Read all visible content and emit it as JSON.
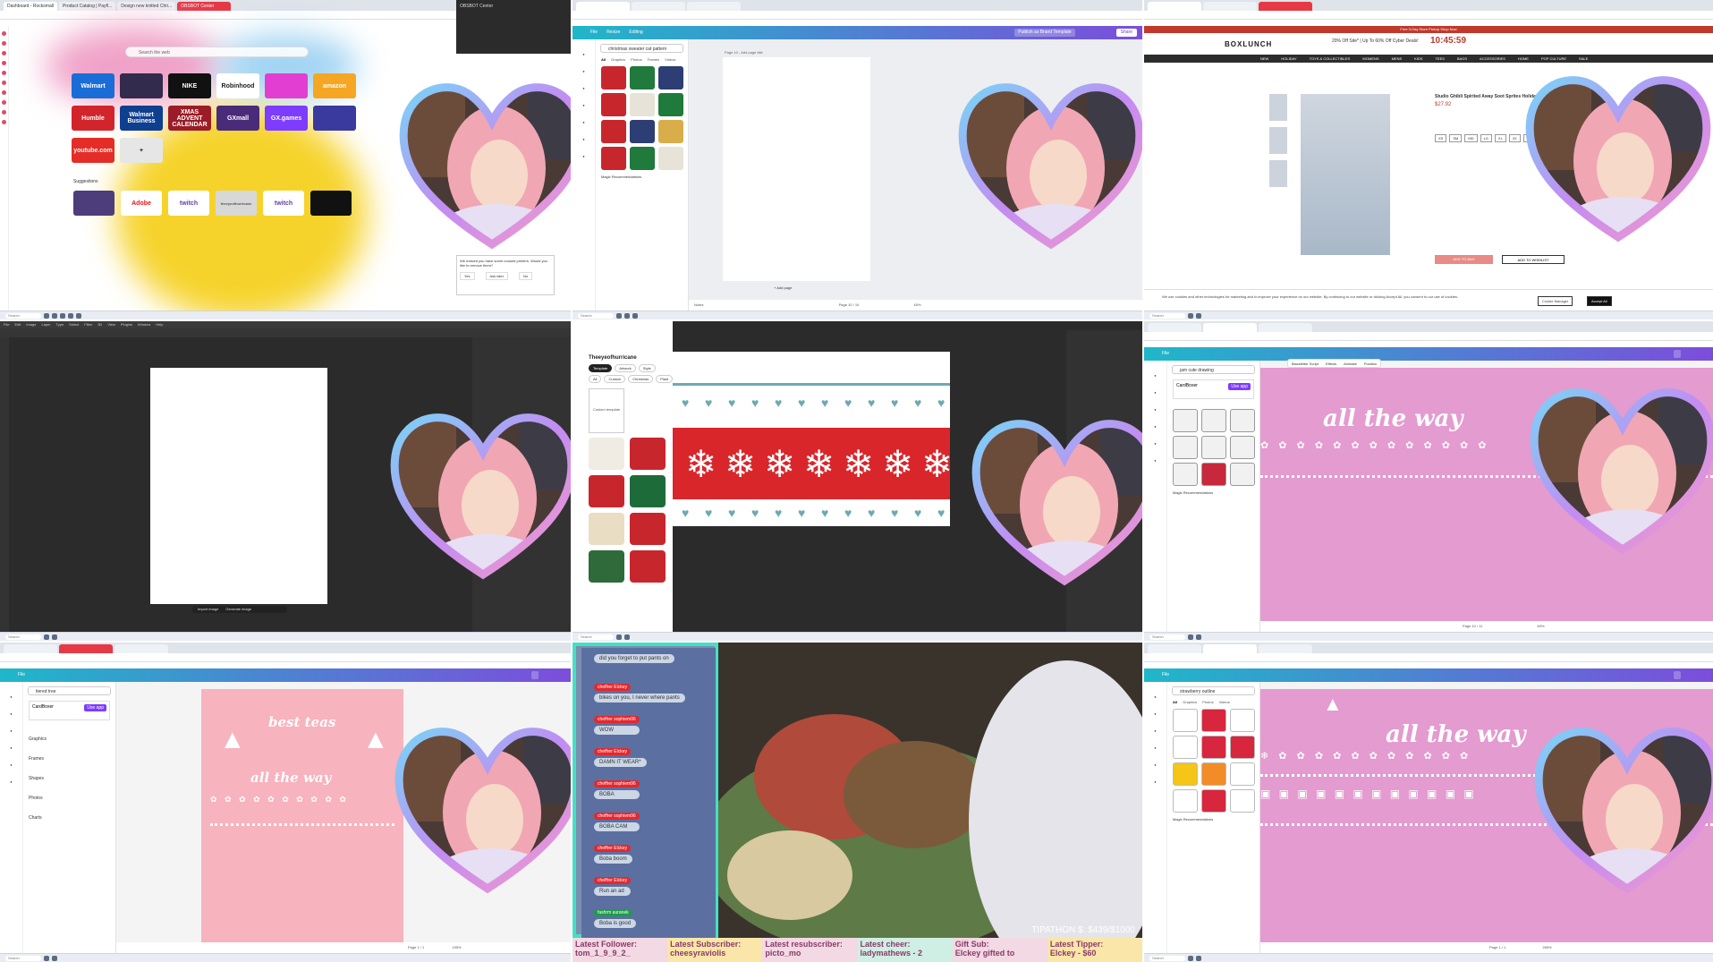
{
  "taskbar": {
    "search": "Search"
  },
  "cell1": {
    "tabs": [
      "Dashboard - Rocksmall",
      "Product Catalog | Payfl...",
      "Design new knitted Chri...",
      "OBSBOT Center"
    ],
    "search_placeholder": "Search the web",
    "speed_dial": [
      {
        "label": "Walmart",
        "color": "#1a6dd6"
      },
      {
        "label": "",
        "color": "#332b4d"
      },
      {
        "label": "NIKE",
        "color": "#111111"
      },
      {
        "label": "Robinhood",
        "color": "#ffffff"
      },
      {
        "label": "",
        "color": "#e23fd2"
      },
      {
        "label": "amazon",
        "color": "#f5a623"
      },
      {
        "label": "Humble",
        "color": "#d2252b"
      },
      {
        "label": "Walmart Business",
        "color": "#0f3f8f"
      },
      {
        "label": "XMAS ADVENT CALENDAR",
        "color": "#9b1c26"
      },
      {
        "label": "GXmall",
        "color": "#4a2b7a"
      },
      {
        "label": "GX.games",
        "color": "#7d3cff"
      },
      {
        "label": "",
        "color": "#3a3a9e"
      },
      {
        "label": "youtube.com",
        "color": "#e52d27"
      },
      {
        "label": "+",
        "color": "#e6e6e6"
      }
    ],
    "suggestions_label": "Suggestions",
    "suggestions": [
      "",
      "Adobe",
      "twitch",
      "theeyeofhurricane",
      "twitch",
      ""
    ],
    "obsbot_title": "OBSBOT Center",
    "popup_text": "We noticed you have some unused printers. Would you like to remove them?",
    "popup_buttons": [
      "Yes",
      "Ask later",
      "No"
    ]
  },
  "cell2": {
    "menu": [
      "File",
      "Resize",
      "Editing"
    ],
    "publish": "Publish as Brand Template",
    "share": "Share",
    "search": "christmas sweater cat pattern",
    "panel_tabs": [
      "All",
      "Graphics",
      "Photos",
      "Frames",
      "Videos"
    ],
    "magic": "Magic Recommendations",
    "page_label": "Page 10 - Add page title",
    "add_page": "+ Add page",
    "notes": "Notes",
    "page_count": "Page 10 / 10",
    "zoom": "45%"
  },
  "cell3": {
    "promo": "Free 3-Day Store Pickup Shop Now",
    "logo": "BOXLUNCH",
    "sale": "20% Off Site* | Up To 60% Off Cyber Deals!",
    "timer": "10:45:59",
    "nav": [
      "NEW",
      "HOLIDAY",
      "TOYS & COLLECTIBLES",
      "WOMENS",
      "MENS",
      "KIDS",
      "TEES",
      "BAGS",
      "ACCESSORIES",
      "HOME",
      "POP CULTURE",
      "SALE"
    ],
    "product_title": "Studio Ghibli Spirited Away Soot Sprites Holiday Sweater",
    "price": "$27.92",
    "sizes": [
      "XS",
      "SM",
      "MD",
      "LG",
      "XL",
      "2X",
      "3X"
    ],
    "add_to_bag": "ADD TO BAG",
    "add_to_wishlist": "ADD TO WISHLIST",
    "cookie_text": "We use cookies and other technologies for marketing and to improve your experience on our website. By continuing to our website or clicking Accept All, you consent to our use of cookies.",
    "cookie_manager": "Cookie Manager",
    "accept_all": "Accept All"
  },
  "cell4": {
    "menu": [
      "File",
      "Edit",
      "Image",
      "Layer",
      "Type",
      "Select",
      "Filter",
      "3D",
      "View",
      "Plugins",
      "Window",
      "Help"
    ],
    "context": [
      "Import image",
      "Generate image"
    ]
  },
  "cell5": {
    "shop": "Theeyeofhurricane",
    "chips": [
      "Template",
      "Artwork",
      "Style",
      "Pattern"
    ],
    "chips2": [
      "All",
      "Custom",
      "Christmas",
      "Plaid"
    ],
    "custom_template": "Custom template"
  },
  "cell6": {
    "search": "jam cute drawing",
    "font": "Blackletter Script",
    "effects": [
      "Effects",
      "Animate",
      "Position"
    ],
    "title": "all the way",
    "app": "CardBoxer",
    "app_btn": "Use app",
    "magic": "Magic Recommendations",
    "page": "Page 10 / 11",
    "zoom": "83%"
  },
  "cell7": {
    "title1": "best teas",
    "title2": "all the way",
    "search": "tiered tree",
    "sections": [
      "Graphics",
      "Frames",
      "Shapes",
      "Photos",
      "Charts"
    ],
    "app": "CardBoxer",
    "app_btn": "Use app",
    "page": "Page 1 / 1",
    "zoom": "155%"
  },
  "cell8": {
    "chat": [
      {
        "name": "",
        "text": "did you forget to put pants on"
      },
      {
        "name": "cheffrer  Elckey",
        "text": "bikes on you, I never where pants"
      },
      {
        "name": "cheffrer  sophiem96",
        "text": "WOW"
      },
      {
        "name": "cheffrer  Elckey",
        "text": "DAMN IT WEAR*"
      },
      {
        "name": "cheffrer  sophiem96",
        "text": "BOBA"
      },
      {
        "name": "cheffrer  sophiem96",
        "text": "BOBA CAM"
      },
      {
        "name": "cheffrer  Elckey",
        "text": "Boba boom"
      },
      {
        "name": "cheffrer  Elckey",
        "text": "Run an ad"
      },
      {
        "name": "fashrm  auranek",
        "text": "Boba is good"
      }
    ],
    "tipathon": "TIPATHON $: $439/$1000",
    "tickers": [
      {
        "label": "Latest Follower:",
        "value": "tom_1_9_9_2_"
      },
      {
        "label": "Latest Subscriber:",
        "value": "cheesyraviolis"
      },
      {
        "label": "Latest resubscriber:",
        "value": "picto_mo"
      },
      {
        "label": "Latest cheer:",
        "value": "ladymathews - 2"
      },
      {
        "label": "Gift Sub:",
        "value": "Elckey gifted to"
      },
      {
        "label": "Latest Tipper:",
        "value": "Elckey - $60"
      }
    ]
  },
  "cell9": {
    "search": "strawberry outline",
    "panel_tabs": [
      "All",
      "Graphics",
      "Photos",
      "Videos",
      "Frames"
    ],
    "title": "all the way",
    "magic": "Magic Recommendations",
    "page": "Page 1 / 1",
    "zoom": "265%"
  }
}
